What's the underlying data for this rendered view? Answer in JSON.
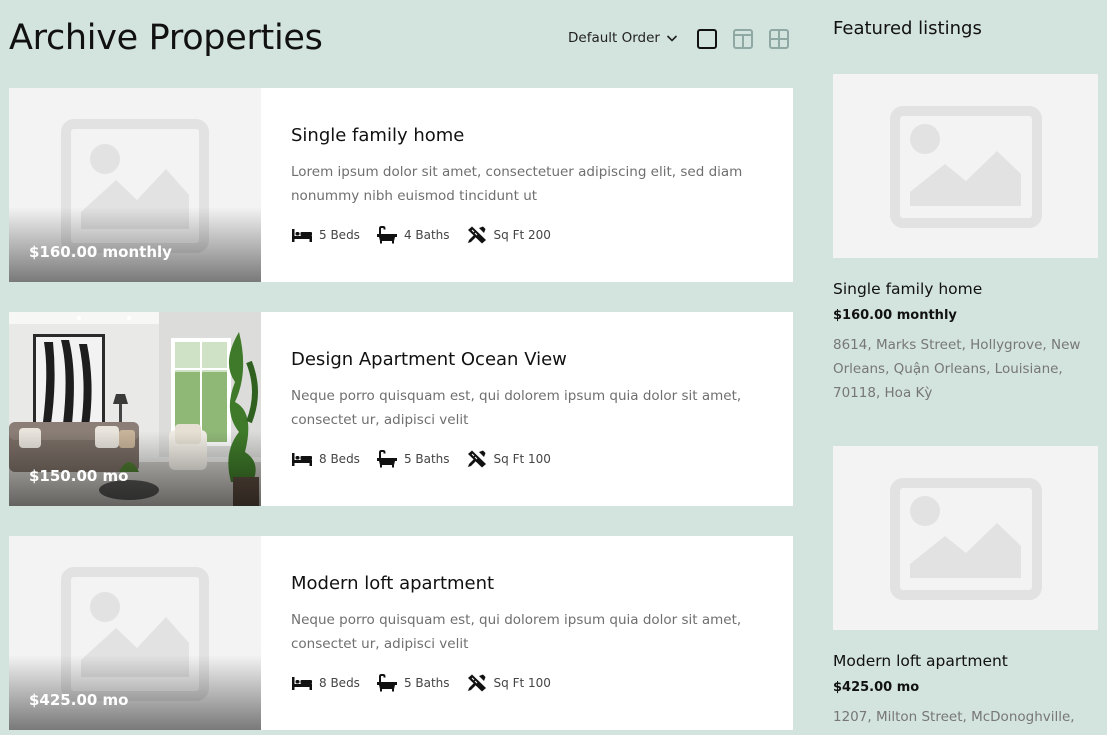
{
  "archive": {
    "title": "Archive Properties",
    "order_label": "Default Order"
  },
  "view_modes": [
    "list-view-icon",
    "two-column-view-icon",
    "grid-view-icon"
  ],
  "listings": [
    {
      "title": "Single family home",
      "description": "Lorem ipsum dolor sit amet, consectetuer adipiscing elit, sed diam nonummy nibh euismod tincidunt ut",
      "price": "$160.00 monthly",
      "beds": "5 Beds",
      "baths": "4 Baths",
      "area": "Sq Ft 200",
      "image": "placeholder"
    },
    {
      "title": "Design Apartment Ocean View",
      "description": "Neque porro quisquam est, qui dolorem ipsum quia dolor sit amet, consectet ur, adipisci velit",
      "price": "$150.00 mo",
      "beds": "8 Beds",
      "baths": "5 Baths",
      "area": "Sq Ft 100",
      "image": "living-room-photo"
    },
    {
      "title": "Modern loft apartment",
      "description": "Neque porro quisquam est, qui dolorem ipsum quia dolor sit amet, consectet ur, adipisci velit",
      "price": "$425.00 mo",
      "beds": "8 Beds",
      "baths": "5 Baths",
      "area": "Sq Ft 100",
      "image": "placeholder"
    }
  ],
  "featured": {
    "title": "Featured listings",
    "items": [
      {
        "name": "Single family home",
        "price": "$160.00 monthly",
        "address": "8614, Marks Street, Hollygrove, New Orleans, Quận Orleans, Louisiane, 70118, Hoa Kỳ"
      },
      {
        "name": "Modern loft apartment",
        "price": "$425.00 mo",
        "address": "1207, Milton Street, McDonoghville,"
      }
    ]
  },
  "colors": {
    "background": "#d3e3de",
    "card": "#ffffff",
    "placeholder_bg": "#f3f3f3",
    "placeholder_icon": "#e2e2e2"
  }
}
